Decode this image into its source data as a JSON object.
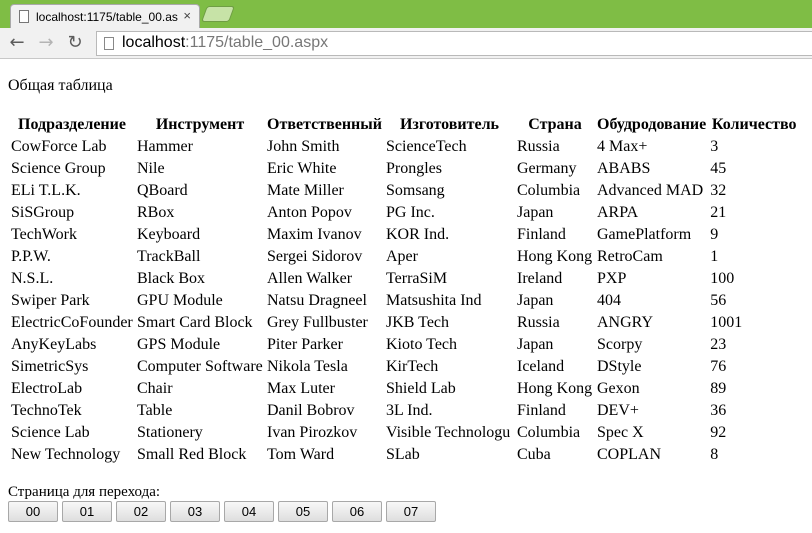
{
  "browser": {
    "tab_title": "localhost:1175/table_00.as",
    "tab_close_glyph": "×",
    "back_glyph": "←",
    "forward_glyph": "→",
    "reload_glyph": "↻",
    "url_host": "localhost",
    "url_path": ":1175/table_00.aspx"
  },
  "page": {
    "heading": "Общая таблица",
    "columns": [
      "Подразделение",
      "Инструмент",
      "Ответственный",
      "Изготовитель",
      "Страна",
      "Обудродование",
      "Количество"
    ],
    "rows": [
      [
        "CowForce Lab",
        "Hammer",
        "John Smith",
        "ScienceTech",
        "Russia",
        "4 Max+",
        "3"
      ],
      [
        "Science Group",
        "Nile",
        "Eric White",
        "Prongles",
        "Germany",
        "ABABS",
        "45"
      ],
      [
        "ELi T.L.K.",
        "QBoard",
        "Mate Miller",
        "Somsang",
        "Columbia",
        "Advanced MAD",
        "32"
      ],
      [
        "SiSGroup",
        "RBox",
        "Anton Popov",
        "PG Inc.",
        "Japan",
        "ARPA",
        "21"
      ],
      [
        "TechWork",
        "Keyboard",
        "Maxim Ivanov",
        "KOR Ind.",
        "Finland",
        "GamePlatform",
        "9"
      ],
      [
        "P.P.W.",
        "TrackBall",
        "Sergei Sidorov",
        "Aper",
        "Hong Kong",
        "RetroCam",
        "1"
      ],
      [
        "N.S.L.",
        "Black Box",
        "Allen Walker",
        "TerraSiM",
        "Ireland",
        "PXP",
        "100"
      ],
      [
        "Swiper Park",
        "GPU Module",
        "Natsu Dragneel",
        "Matsushita Ind",
        "Japan",
        "404",
        "56"
      ],
      [
        "ElectricCoFounder",
        "Smart Card Block",
        "Grey Fullbuster",
        "JKB Tech",
        "Russia",
        "ANGRY",
        "1001"
      ],
      [
        "AnyKeyLabs",
        "GPS Module",
        "Piter Parker",
        "Kioto Tech",
        "Japan",
        "Scorpy",
        "23"
      ],
      [
        "SimetricSys",
        "Computer Software",
        "Nikola Tesla",
        "KirTech",
        "Iceland",
        "DStyle",
        "76"
      ],
      [
        "ElectroLab",
        "Chair",
        "Max Luter",
        "Shield Lab",
        "Hong Kong",
        "Gexon",
        "89"
      ],
      [
        "TechnoTek",
        "Table",
        "Danil Bobrov",
        "3L Ind.",
        "Finland",
        "DEV+",
        "36"
      ],
      [
        "Science Lab",
        "Stationery",
        "Ivan Pirozkov",
        "Visible Technologu",
        "Columbia",
        "Spec X",
        "92"
      ],
      [
        "New Technology",
        "Small Red Block",
        "Tom Ward",
        "SLab",
        "Cuba",
        "COPLAN",
        "8"
      ]
    ],
    "pager_label": "Страница для перехода:",
    "pages": [
      "00",
      "01",
      "02",
      "03",
      "04",
      "05",
      "06",
      "07"
    ]
  },
  "colors": {
    "tabstrip": "#7fbd45",
    "toolbar": "#f1f1f1"
  }
}
